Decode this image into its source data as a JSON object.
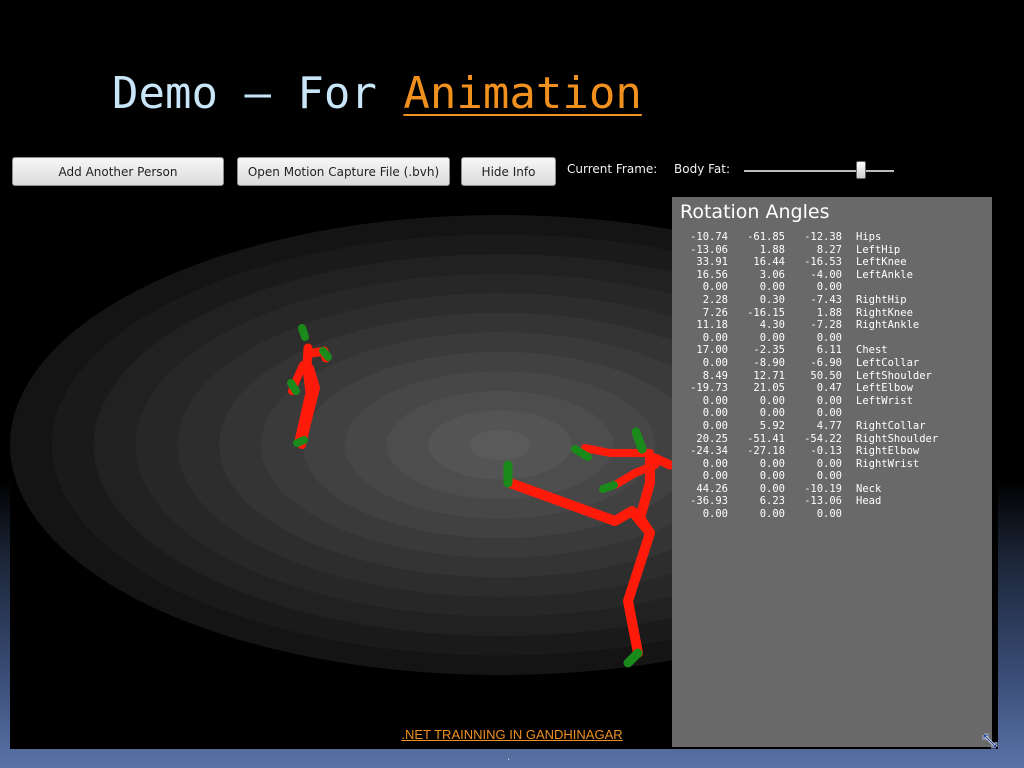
{
  "title": {
    "prefix": "Demo – For ",
    "accent": "Animation"
  },
  "toolbar": {
    "add_person": "Add Another Person",
    "open_bvh": "Open Motion Capture File (.bvh)",
    "hide_info": "Hide Info",
    "current_frame_label": "Current Frame:",
    "body_fat_label": "Body Fat:",
    "body_fat_level": 0.78
  },
  "info": {
    "title": "Rotation Angles",
    "rows": [
      {
        "a": "-10.74",
        "b": "-61.85",
        "c": "-12.38",
        "name": "Hips"
      },
      {
        "a": "-13.06",
        "b": "1.88",
        "c": "8.27",
        "name": "LeftHip"
      },
      {
        "a": "33.91",
        "b": "16.44",
        "c": "-16.53",
        "name": "LeftKnee"
      },
      {
        "a": "16.56",
        "b": "3.06",
        "c": "-4.00",
        "name": "LeftAnkle"
      },
      {
        "a": "0.00",
        "b": "0.00",
        "c": "0.00",
        "name": ""
      },
      {
        "a": "2.28",
        "b": "0.30",
        "c": "-7.43",
        "name": "RightHip"
      },
      {
        "a": "7.26",
        "b": "-16.15",
        "c": "1.88",
        "name": "RightKnee"
      },
      {
        "a": "11.18",
        "b": "4.30",
        "c": "-7.28",
        "name": "RightAnkle"
      },
      {
        "a": "0.00",
        "b": "0.00",
        "c": "0.00",
        "name": ""
      },
      {
        "a": "17.00",
        "b": "-2.35",
        "c": "6.11",
        "name": "Chest"
      },
      {
        "a": "0.00",
        "b": "-8.90",
        "c": "-6.90",
        "name": "LeftCollar"
      },
      {
        "a": "8.49",
        "b": "12.71",
        "c": "50.50",
        "name": "LeftShoulder"
      },
      {
        "a": "-19.73",
        "b": "21.05",
        "c": "0.47",
        "name": "LeftElbow"
      },
      {
        "a": "0.00",
        "b": "0.00",
        "c": "0.00",
        "name": "LeftWrist"
      },
      {
        "a": "0.00",
        "b": "0.00",
        "c": "0.00",
        "name": ""
      },
      {
        "a": "0.00",
        "b": "5.92",
        "c": "4.77",
        "name": "RightCollar"
      },
      {
        "a": "20.25",
        "b": "-51.41",
        "c": "-54.22",
        "name": "RightShoulder"
      },
      {
        "a": "-24.34",
        "b": "-27.18",
        "c": "-0.13",
        "name": "RightElbow"
      },
      {
        "a": "0.00",
        "b": "0.00",
        "c": "0.00",
        "name": "RightWrist"
      },
      {
        "a": "0.00",
        "b": "0.00",
        "c": "0.00",
        "name": ""
      },
      {
        "a": "44.26",
        "b": "0.00",
        "c": "-10.19",
        "name": "Neck"
      },
      {
        "a": "-36.93",
        "b": "6.23",
        "c": "-13.06",
        "name": "Head"
      },
      {
        "a": "0.00",
        "b": "0.00",
        "c": "0.00",
        "name": ""
      }
    ]
  },
  "footer": {
    "link": ".NET TRAINNING IN GANDHINAGAR",
    "dot": "."
  },
  "colors": {
    "accent": "#f0901e",
    "bone": "#ff1a0a",
    "joint": "#1a8a1a",
    "panel": "#696969"
  }
}
